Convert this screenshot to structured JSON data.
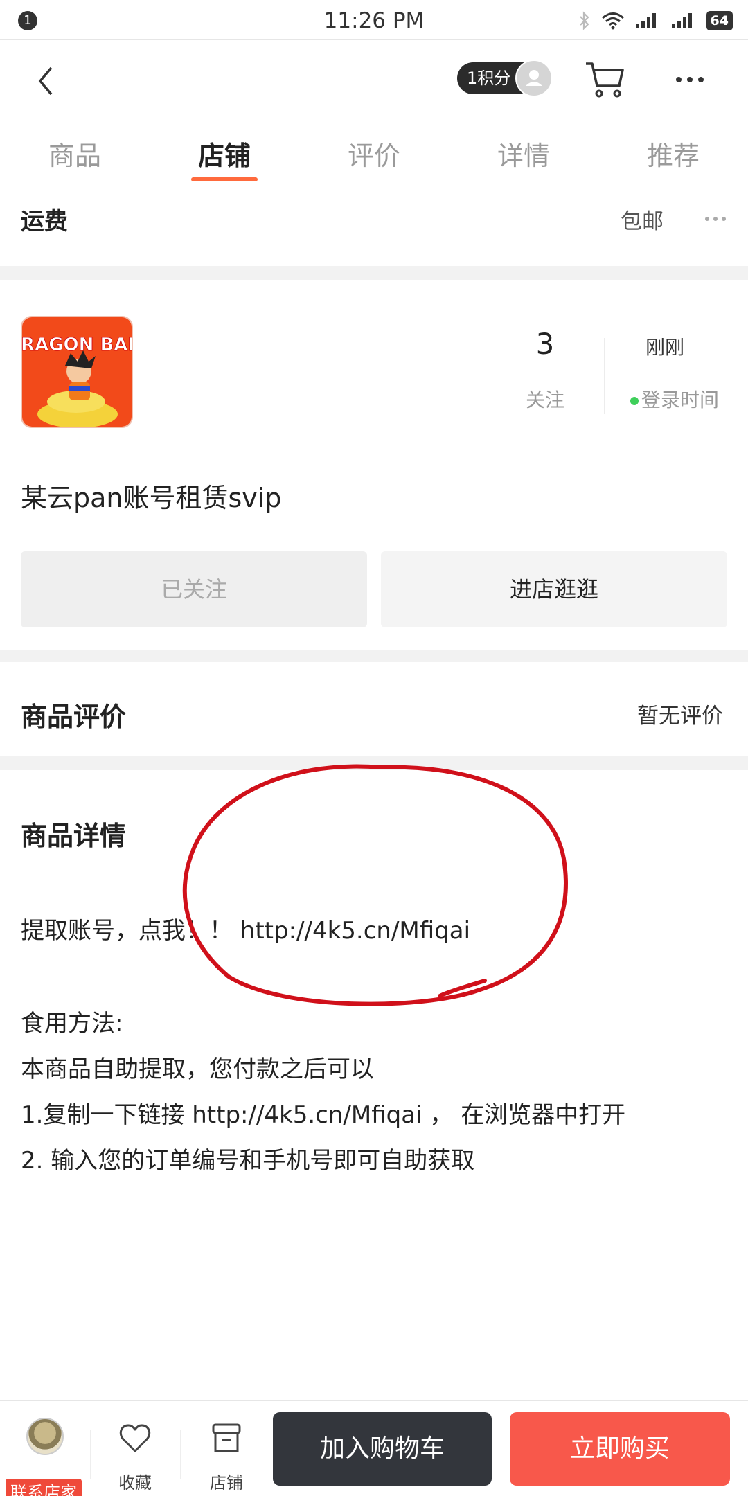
{
  "status_bar": {
    "notification_count": "1",
    "time": "11:26 PM",
    "battery": "64"
  },
  "nav": {
    "points_label": "1积分"
  },
  "tabs": [
    {
      "label": "商品"
    },
    {
      "label": "店铺"
    },
    {
      "label": "评价"
    },
    {
      "label": "详情"
    },
    {
      "label": "推荐"
    }
  ],
  "active_tab": "店铺",
  "shipping": {
    "label": "运费",
    "value": "包邮"
  },
  "shop": {
    "logo_text": "DRAGON BALL",
    "followers_count": "3",
    "followers_label": "关注",
    "last_login_value": "刚刚",
    "last_login_label": "登录时间",
    "name": "某云pan账号租赁svip",
    "followed_button": "已关注",
    "enter_shop_button": "进店逛逛"
  },
  "reviews": {
    "title": "商品评价",
    "status": "暂无评价"
  },
  "details": {
    "title": "商品详情",
    "lines": [
      "提取账号，点我！！ http://4k5.cn/Mfiqai",
      "食用方法:",
      "本商品自助提取，您付款之后可以",
      "1.复制一下链接 http://4k5.cn/Mfiqai ， 在浏览器中打开",
      "2. 输入您的订单编号和手机号即可自助获取"
    ]
  },
  "bottom_bar": {
    "contact_label": "联系店家",
    "favorite_label": "收藏",
    "shop_label": "店铺",
    "add_to_cart": "加入购物车",
    "buy_now": "立即购买"
  },
  "colors": {
    "accent": "#ff6a3d",
    "buy_button": "#f8584b",
    "cart_button": "#33363c",
    "annotation_circle": "#d0101a",
    "online_dot": "#3ecf5a"
  },
  "icons": [
    "back-icon",
    "user-avatar-icon",
    "cart-icon",
    "more-icon",
    "heart-icon",
    "shop-icon",
    "wifi-icon",
    "bluetooth-icon",
    "signal-icon"
  ]
}
